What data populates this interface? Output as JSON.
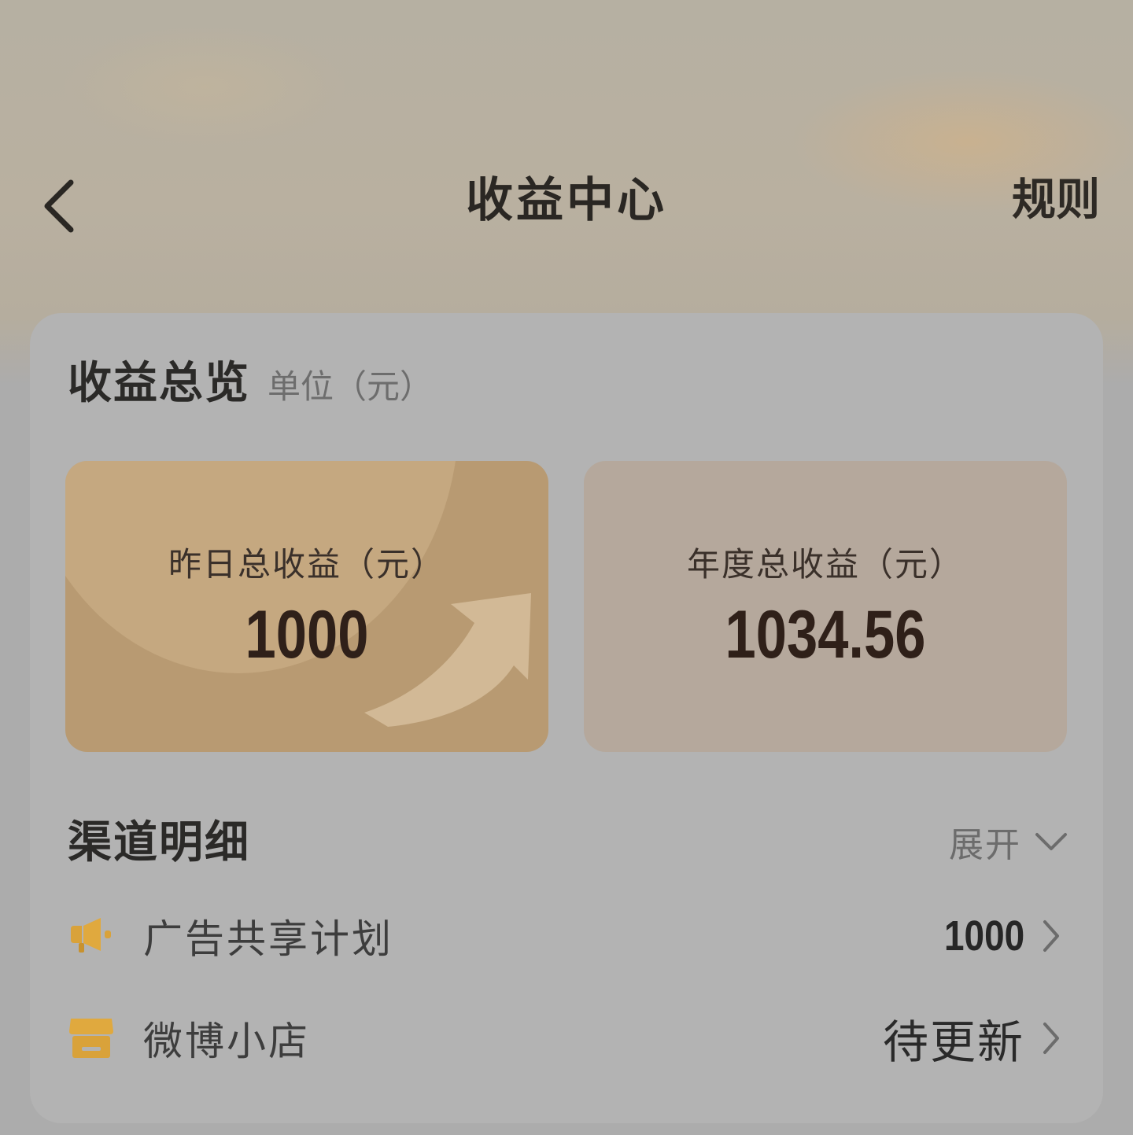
{
  "header": {
    "title": "收益中心",
    "rules_label": "规则"
  },
  "overview": {
    "title": "收益总览",
    "unit_label": "单位（元）",
    "yesterday": {
      "label": "昨日总收益（元）",
      "value": "1000"
    },
    "yearly": {
      "label": "年度总收益（元）",
      "value": "1034.56"
    }
  },
  "channels": {
    "title": "渠道明细",
    "expand_label": "展开",
    "items": [
      {
        "name": "广告共享计划",
        "value": "1000",
        "icon": "megaphone-icon"
      },
      {
        "name": "微博小店",
        "value": "待更新",
        "icon": "shop-icon"
      }
    ]
  },
  "colors": {
    "accent_gold": "#d9a23a",
    "card_yesterday": "#b89a72",
    "card_yearly": "#b5a89c"
  }
}
